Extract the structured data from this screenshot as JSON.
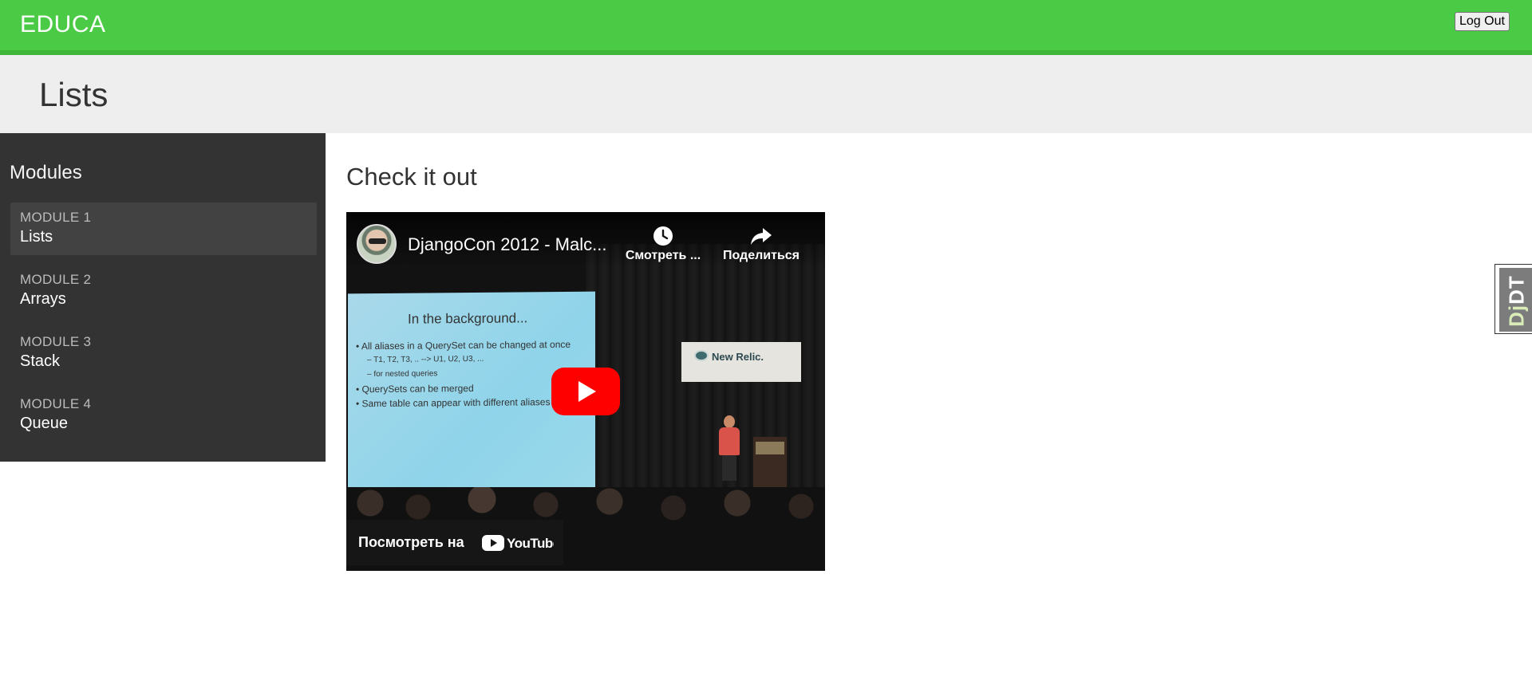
{
  "header": {
    "brand": "EDUCA",
    "logout_label": "Log Out",
    "bg_color": "#4bcb45"
  },
  "page": {
    "title": "Lists"
  },
  "sidebar": {
    "title": "Modules",
    "items": [
      {
        "number": "MODULE 1",
        "name": "Lists",
        "active": true
      },
      {
        "number": "MODULE 2",
        "name": "Arrays",
        "active": false
      },
      {
        "number": "MODULE 3",
        "name": "Stack",
        "active": false
      },
      {
        "number": "MODULE 4",
        "name": "Queue",
        "active": false
      }
    ]
  },
  "content": {
    "title": "Check it out"
  },
  "video": {
    "title": "DjangoCon 2012 - Malc...",
    "watch_later_label": "Смотреть ...",
    "share_label": "Поделиться",
    "watch_on_label": "Посмотреть на",
    "youtube_label": "YouTube",
    "slide": {
      "heading": "In the background...",
      "lines": [
        "All aliases in a QuerySet can be changed at once",
        "T1, T2, T3, ..  --> U1, U2, U3, ...",
        "for nested queries",
        "QuerySets can be merged",
        "Same table can appear with different aliases"
      ]
    },
    "banner_text": "New Relic."
  },
  "debug_toolbar": {
    "label_prefix": "Dj",
    "label_suffix": "DT"
  }
}
